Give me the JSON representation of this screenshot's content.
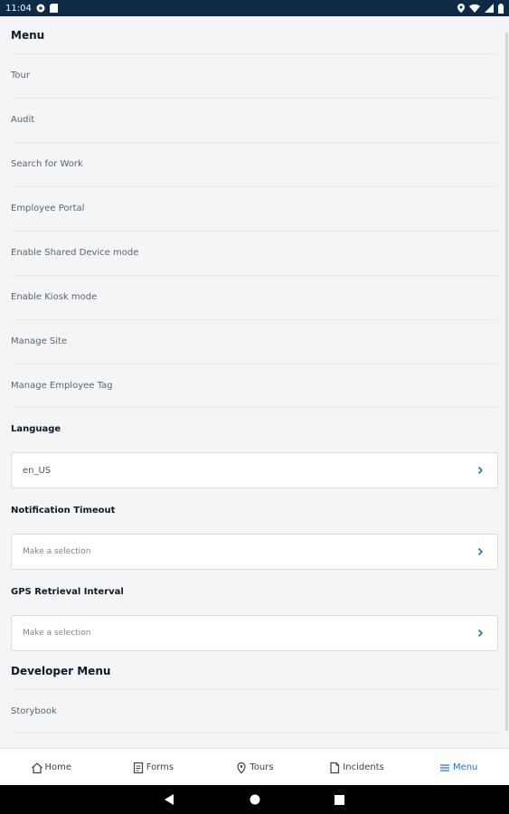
{
  "status_bar": {
    "time": "11:04"
  },
  "menu": {
    "title": "Menu",
    "items": [
      {
        "label": "Tour"
      },
      {
        "label": "Audit"
      },
      {
        "label": "Search for Work"
      },
      {
        "label": "Employee Portal"
      },
      {
        "label": "Enable Shared Device mode"
      },
      {
        "label": "Enable Kiosk mode"
      },
      {
        "label": "Manage Site"
      },
      {
        "label": "Manage Employee Tag"
      }
    ]
  },
  "language": {
    "label": "Language",
    "value": "en_US"
  },
  "notification_timeout": {
    "label": "Notification Timeout",
    "placeholder": "Make a selection"
  },
  "gps_interval": {
    "label": "GPS Retrieval Interval",
    "placeholder": "Make a selection"
  },
  "developer_menu": {
    "title": "Developer Menu",
    "items": [
      {
        "label": "Storybook"
      }
    ]
  },
  "tab_bar": {
    "tabs": [
      {
        "label": "Home",
        "icon": "home-icon"
      },
      {
        "label": "Forms",
        "icon": "forms-icon"
      },
      {
        "label": "Tours",
        "icon": "tours-icon"
      },
      {
        "label": "Incidents",
        "icon": "incidents-icon"
      },
      {
        "label": "Menu",
        "icon": "menu-icon",
        "active": true
      }
    ],
    "active_color": "#2c6fb6"
  },
  "colors": {
    "status_bar_bg": "#0e2a47",
    "page_bg": "#f4f5f7",
    "chevron": "#2c6fb6"
  }
}
